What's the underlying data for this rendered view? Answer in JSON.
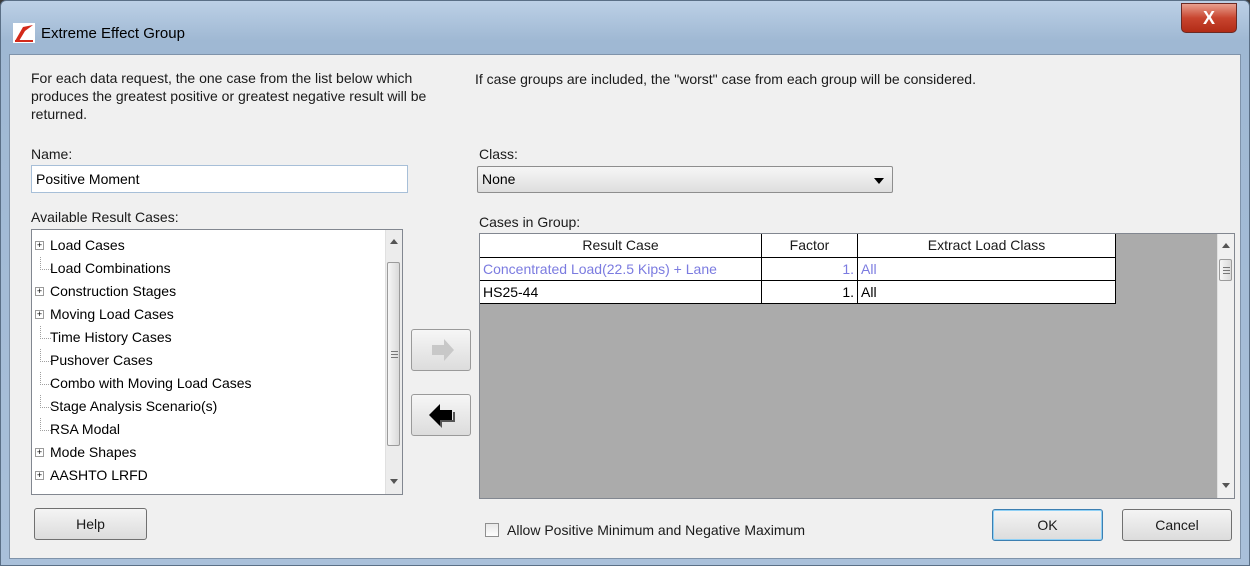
{
  "window": {
    "title": "Extreme Effect Group",
    "close_label": "X"
  },
  "left_description": "For each data request, the one case from the list below which produces the greatest positive or greatest negative result will be returned.",
  "right_description": "If case groups are included, the \"worst\" case from each group will be considered.",
  "name_field": {
    "label": "Name:",
    "value": "Positive Moment"
  },
  "class_field": {
    "label": "Class:",
    "value": "None"
  },
  "available": {
    "label": "Available Result Cases:",
    "items": [
      {
        "label": "Load Cases",
        "expandable": true
      },
      {
        "label": "Load Combinations",
        "expandable": false
      },
      {
        "label": "Construction Stages",
        "expandable": true
      },
      {
        "label": "Moving Load Cases",
        "expandable": true
      },
      {
        "label": "Time History Cases",
        "expandable": false
      },
      {
        "label": "Pushover Cases",
        "expandable": false
      },
      {
        "label": "Combo with Moving Load Cases",
        "expandable": false
      },
      {
        "label": "Stage Analysis Scenario(s)",
        "expandable": false
      },
      {
        "label": "RSA Modal",
        "expandable": false
      },
      {
        "label": "Mode Shapes",
        "expandable": true
      },
      {
        "label": "AASHTO LRFD",
        "expandable": true
      }
    ]
  },
  "group": {
    "label": "Cases in Group:",
    "columns": [
      "Result Case",
      "Factor",
      "Extract Load Class"
    ],
    "rows": [
      {
        "case": "Concentrated Load(22.5 Kips) + Lane",
        "factor": "1.",
        "class": "All",
        "highlighted": true
      },
      {
        "case": "HS25-44",
        "factor": "1.",
        "class": "All",
        "highlighted": false
      }
    ]
  },
  "allow_checkbox": {
    "label": "Allow Positive Minimum and Negative Maximum",
    "checked": false
  },
  "buttons": {
    "help": "Help",
    "ok": "OK",
    "cancel": "Cancel"
  },
  "colors": {
    "highlight_text": "#7b7be0",
    "title_gradient_top": "#bcd0e6",
    "close_button": "#c8452f",
    "dialog_bg": "#f0f0f0",
    "grid_bg": "#ababab"
  }
}
